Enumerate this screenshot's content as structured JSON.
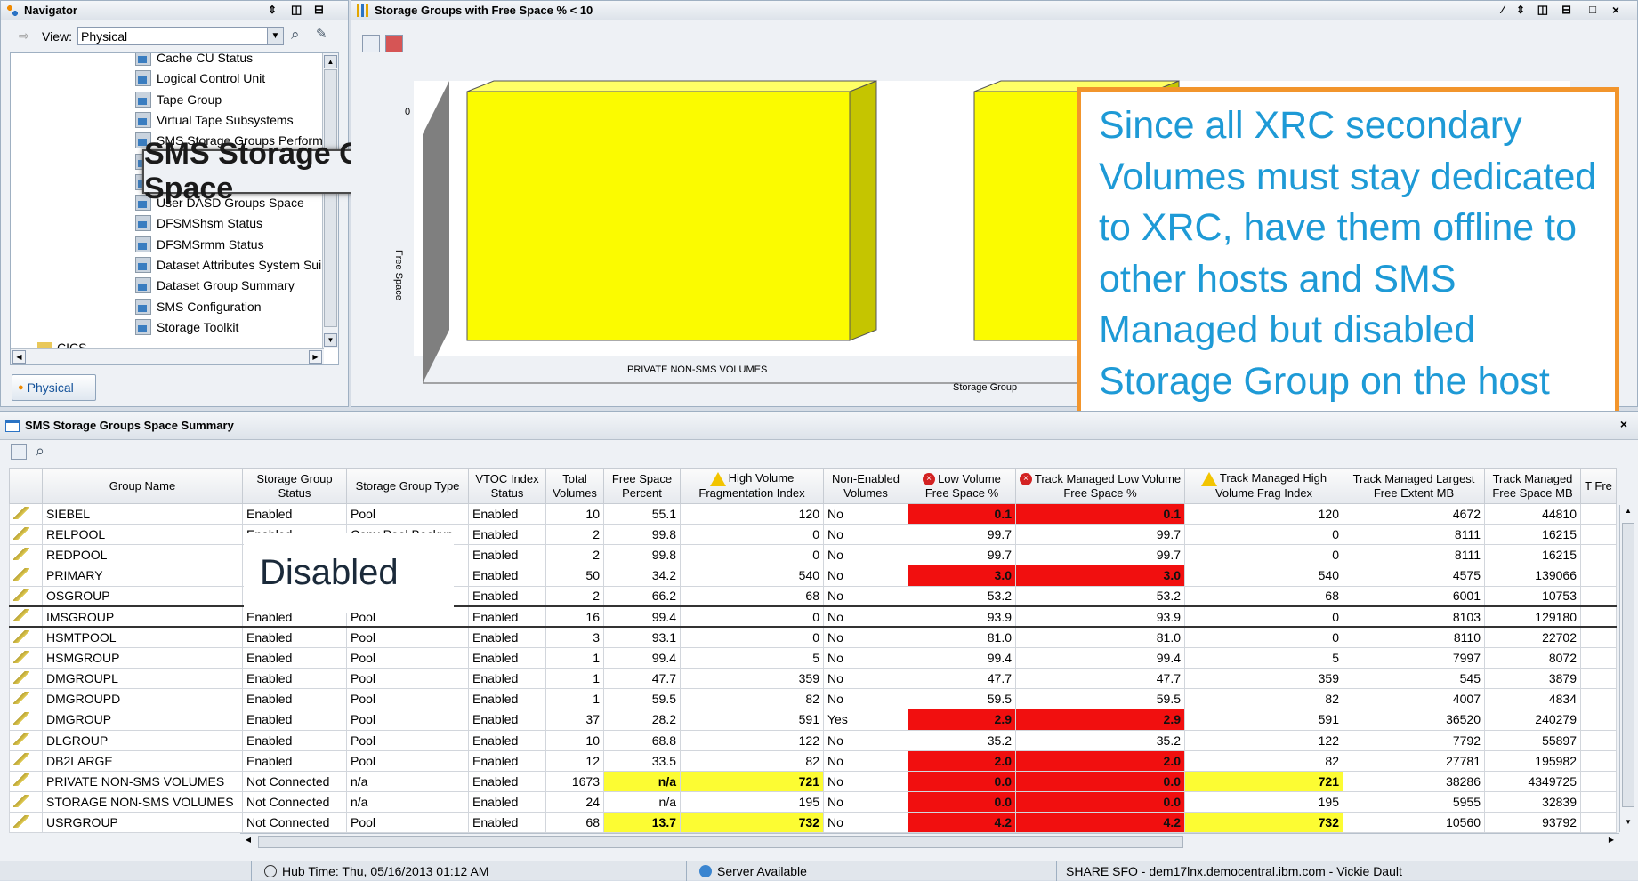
{
  "navigator": {
    "title": "Navigator",
    "view_label": "View:",
    "view_value": "Physical",
    "tree_items": [
      {
        "label": "Cache CU Status"
      },
      {
        "label": "Logical Control Unit"
      },
      {
        "label": "Tape Group"
      },
      {
        "label": "Virtual Tape Subsystems"
      },
      {
        "label": "SMS Storage Groups Perform"
      },
      {
        "label": ""
      },
      {
        "label": ""
      },
      {
        "label": "User DASD Groups Space"
      },
      {
        "label": "DFSMShsm Status"
      },
      {
        "label": "DFSMSrmm Status"
      },
      {
        "label": "Dataset Attributes System Sui"
      },
      {
        "label": "Dataset Group Summary"
      },
      {
        "label": "SMS Configuration"
      },
      {
        "label": "Storage Toolkit"
      }
    ],
    "below_item": "CICS...",
    "callout": "SMS Storage Groups Space",
    "tab_label": "Physical"
  },
  "chart_panel": {
    "title": "Storage Groups with Free Space % < 10",
    "callout": "Since all XRC secondary Volumes must stay dedicated to XRC, have them offline to other hosts and SMS Managed  but disabled Storage Group on the host with SDM"
  },
  "chart_data": {
    "type": "bar",
    "title": "",
    "xlabel": "Storage Group",
    "ylabel": "Free Space",
    "categories": [
      "PRIVATE NON-SMS VOLUMES",
      ""
    ],
    "values": [
      0,
      0
    ],
    "y_tick": "0"
  },
  "summary": {
    "title": "SMS Storage Groups Space Summary",
    "disabled_overlay": "Disabled",
    "columns": [
      {
        "label": "Group Name"
      },
      {
        "label": "Storage Group Status"
      },
      {
        "label": "Storage Group Type"
      },
      {
        "label": "VTOC Index Status"
      },
      {
        "label": "Total Volumes"
      },
      {
        "label": "Free Space Percent"
      },
      {
        "label": "High Volume Fragmentation Index",
        "icon": "warning"
      },
      {
        "label": "Non-Enabled Volumes"
      },
      {
        "label": "Low Volume Free Space %",
        "icon": "error"
      },
      {
        "label": "Track Managed Low Volume Free Space %",
        "icon": "error"
      },
      {
        "label": "Track Managed High Volume Frag Index",
        "icon": "warning"
      },
      {
        "label": "Track Managed Largest Free Extent MB"
      },
      {
        "label": "Track Managed Free Space MB"
      },
      {
        "label": "T Fre"
      }
    ],
    "rows": [
      {
        "name": "SIEBEL",
        "status": "Enabled",
        "type": "Pool",
        "vtoc": "Enabled",
        "total": "10",
        "free": "55.1",
        "frag": "120",
        "nonen": "No",
        "low": "0.1",
        "tmlow": "0.1",
        "tmfrag": "120",
        "tmlarge": "4672",
        "tmfree": "44810",
        "lowColor": "red"
      },
      {
        "name": "RELPOOL",
        "status": "Enabled",
        "type": "Copy Pool Backup",
        "vtoc": "Enabled",
        "total": "2",
        "free": "99.8",
        "frag": "0",
        "nonen": "No",
        "low": "99.7",
        "tmlow": "99.7",
        "tmfrag": "0",
        "tmlarge": "8111",
        "tmfree": "16215"
      },
      {
        "name": "REDPOOL",
        "status": "",
        "type": "",
        "vtoc": "Enabled",
        "total": "2",
        "free": "99.8",
        "frag": "0",
        "nonen": "No",
        "low": "99.7",
        "tmlow": "99.7",
        "tmfrag": "0",
        "tmlarge": "8111",
        "tmfree": "16215"
      },
      {
        "name": "PRIMARY",
        "status": "",
        "type": "",
        "vtoc": "Enabled",
        "total": "50",
        "free": "34.2",
        "frag": "540",
        "nonen": "No",
        "low": "3.0",
        "tmlow": "3.0",
        "tmfrag": "540",
        "tmlarge": "4575",
        "tmfree": "139066",
        "lowColor": "red"
      },
      {
        "name": "OSGROUP",
        "status": "",
        "type": "",
        "vtoc": "Enabled",
        "total": "2",
        "free": "66.2",
        "frag": "68",
        "nonen": "No",
        "low": "53.2",
        "tmlow": "53.2",
        "tmfrag": "68",
        "tmlarge": "6001",
        "tmfree": "10753"
      },
      {
        "name": "IMSGROUP",
        "status": "Enabled",
        "type": "Pool",
        "vtoc": "Enabled",
        "total": "16",
        "free": "99.4",
        "frag": "0",
        "nonen": "No",
        "low": "93.9",
        "tmlow": "93.9",
        "tmfrag": "0",
        "tmlarge": "8103",
        "tmfree": "129180",
        "selected": true
      },
      {
        "name": "HSMTPOOL",
        "status": "Enabled",
        "type": "Pool",
        "vtoc": "Enabled",
        "total": "3",
        "free": "93.1",
        "frag": "0",
        "nonen": "No",
        "low": "81.0",
        "tmlow": "81.0",
        "tmfrag": "0",
        "tmlarge": "8110",
        "tmfree": "22702"
      },
      {
        "name": "HSMGROUP",
        "status": "Enabled",
        "type": "Pool",
        "vtoc": "Enabled",
        "total": "1",
        "free": "99.4",
        "frag": "5",
        "nonen": "No",
        "low": "99.4",
        "tmlow": "99.4",
        "tmfrag": "5",
        "tmlarge": "7997",
        "tmfree": "8072"
      },
      {
        "name": "DMGROUPL",
        "status": "Enabled",
        "type": "Pool",
        "vtoc": "Enabled",
        "total": "1",
        "free": "47.7",
        "frag": "359",
        "nonen": "No",
        "low": "47.7",
        "tmlow": "47.7",
        "tmfrag": "359",
        "tmlarge": "545",
        "tmfree": "3879"
      },
      {
        "name": "DMGROUPD",
        "status": "Enabled",
        "type": "Pool",
        "vtoc": "Enabled",
        "total": "1",
        "free": "59.5",
        "frag": "82",
        "nonen": "No",
        "low": "59.5",
        "tmlow": "59.5",
        "tmfrag": "82",
        "tmlarge": "4007",
        "tmfree": "4834"
      },
      {
        "name": "DMGROUP",
        "status": "Enabled",
        "type": "Pool",
        "vtoc": "Enabled",
        "total": "37",
        "free": "28.2",
        "frag": "591",
        "nonen": "Yes",
        "low": "2.9",
        "tmlow": "2.9",
        "tmfrag": "591",
        "tmlarge": "36520",
        "tmfree": "240279",
        "lowColor": "red"
      },
      {
        "name": "DLGROUP",
        "status": "Enabled",
        "type": "Pool",
        "vtoc": "Enabled",
        "total": "10",
        "free": "68.8",
        "frag": "122",
        "nonen": "No",
        "low": "35.2",
        "tmlow": "35.2",
        "tmfrag": "122",
        "tmlarge": "7792",
        "tmfree": "55897"
      },
      {
        "name": "DB2LARGE",
        "status": "Enabled",
        "type": "Pool",
        "vtoc": "Enabled",
        "total": "12",
        "free": "33.5",
        "frag": "82",
        "nonen": "No",
        "low": "2.0",
        "tmlow": "2.0",
        "tmfrag": "82",
        "tmlarge": "27781",
        "tmfree": "195982",
        "lowColor": "red"
      },
      {
        "name": "PRIVATE NON-SMS VOLUMES",
        "status": "Not Connected",
        "type": "n/a",
        "vtoc": "Enabled",
        "total": "1673",
        "free": "n/a",
        "frag": "721",
        "nonen": "No",
        "low": "0.0",
        "tmlow": "0.0",
        "tmfrag": "721",
        "tmlarge": "38286",
        "tmfree": "4349725",
        "lowColor": "red",
        "fragColor": "yellow"
      },
      {
        "name": "STORAGE NON-SMS VOLUMES",
        "status": "Not Connected",
        "type": "n/a",
        "vtoc": "Enabled",
        "total": "24",
        "free": "n/a",
        "frag": "195",
        "nonen": "No",
        "low": "0.0",
        "tmlow": "0.0",
        "tmfrag": "195",
        "tmlarge": "5955",
        "tmfree": "32839",
        "lowColor": "red"
      },
      {
        "name": "USRGROUP",
        "status": "Not Connected",
        "type": "Pool",
        "vtoc": "Enabled",
        "total": "68",
        "free": "13.7",
        "frag": "732",
        "nonen": "No",
        "low": "4.2",
        "tmlow": "4.2",
        "tmfrag": "732",
        "tmlarge": "10560",
        "tmfree": "93792",
        "lowColor": "red",
        "fragColor": "yellow"
      }
    ]
  },
  "status_bar": {
    "hub_time": "Hub Time: Thu, 05/16/2013 01:12 AM",
    "server": "Server Available",
    "info": "SHARE SFO - dem17lnx.democentral.ibm.com - Vickie Dault"
  },
  "colors": {
    "red": "#f10f0f",
    "yellow": "#fcfc33",
    "callout_border": "#f2952c",
    "callout_text": "#1e9ad6"
  }
}
